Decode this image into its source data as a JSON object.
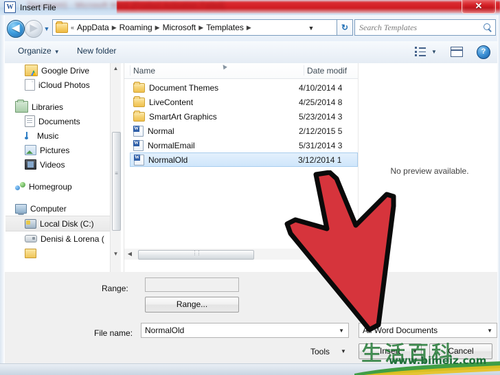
{
  "window": {
    "title": "Insert File",
    "app_icon": "word-icon",
    "close_label": "✕",
    "banner_obscured_text": "Document1 - Microsoft Word (Product Activation Failed)"
  },
  "addressbar": {
    "back_glyph": "◀",
    "forward_glyph": "▶",
    "history_caret": "▼",
    "overflow": "«",
    "crumbs": [
      "AppData",
      "Roaming",
      "Microsoft",
      "Templates"
    ],
    "separator": "▶",
    "dropdown_caret": "▼",
    "refresh_glyph": "↻",
    "search_placeholder": "Search Templates"
  },
  "commandbar": {
    "organize": "Organize",
    "new_folder": "New folder",
    "caret": "▼",
    "help_glyph": "?"
  },
  "sidebar": {
    "items": [
      {
        "label": "Google Drive",
        "icon": "google-drive-icon",
        "indent": true,
        "selected": false
      },
      {
        "label": "iCloud Photos",
        "icon": "icloud-photos-icon",
        "indent": true,
        "selected": false
      },
      {
        "label": "Libraries",
        "icon": "libraries-icon",
        "indent": false,
        "selected": false
      },
      {
        "label": "Documents",
        "icon": "documents-icon",
        "indent": true,
        "selected": false
      },
      {
        "label": "Music",
        "icon": "music-icon",
        "indent": true,
        "selected": false
      },
      {
        "label": "Pictures",
        "icon": "pictures-icon",
        "indent": true,
        "selected": false
      },
      {
        "label": "Videos",
        "icon": "videos-icon",
        "indent": true,
        "selected": false
      },
      {
        "label": "Homegroup",
        "icon": "homegroup-icon",
        "indent": false,
        "selected": false
      },
      {
        "label": "Computer",
        "icon": "computer-icon",
        "indent": false,
        "selected": false
      },
      {
        "label": "Local Disk (C:)",
        "icon": "local-disk-icon",
        "indent": true,
        "selected": true
      },
      {
        "label": "Denisi & Lorena (",
        "icon": "removable-drive-icon",
        "indent": true,
        "selected": false
      }
    ],
    "scroll_up": "▲",
    "scroll_down": "▼"
  },
  "filelist": {
    "columns": [
      "Name",
      "Date modif"
    ],
    "sort_indicator": "▲",
    "rows": [
      {
        "name": "Document Themes",
        "date": "4/10/2014 4",
        "icon": "folder-icon",
        "selected": false
      },
      {
        "name": "LiveContent",
        "date": "4/25/2014 8",
        "icon": "folder-icon",
        "selected": false
      },
      {
        "name": "SmartArt Graphics",
        "date": "5/23/2014 3",
        "icon": "folder-icon",
        "selected": false
      },
      {
        "name": "Normal",
        "date": "2/12/2015 5",
        "icon": "word-template-icon",
        "selected": false
      },
      {
        "name": "NormalEmail",
        "date": "5/31/2014 3",
        "icon": "word-template-icon",
        "selected": false
      },
      {
        "name": "NormalOld",
        "date": "3/12/2014 1",
        "icon": "word-template-icon",
        "selected": true
      }
    ],
    "hscroll_left": "◀",
    "hscroll_grip": "⋮⋮"
  },
  "preview": {
    "message": "No preview available."
  },
  "form": {
    "range_label": "Range:",
    "range_value": "",
    "range_button": "Range...",
    "filename_label": "File name:",
    "filename_value": "NormalOld",
    "filetype_value": "All Word Documents",
    "tools_label": "Tools",
    "insert_label": "Insert",
    "cancel_label": "Cancel",
    "caret": "▼"
  },
  "annotation": {
    "arrow_color": "#d6343c",
    "arrow_outline": "#0a0a0a",
    "arrow_name": "red-pointer-arrow"
  },
  "watermark": {
    "characters": "生活百科",
    "url": "www.bimeiz.com",
    "color": "#1f6f3a"
  }
}
